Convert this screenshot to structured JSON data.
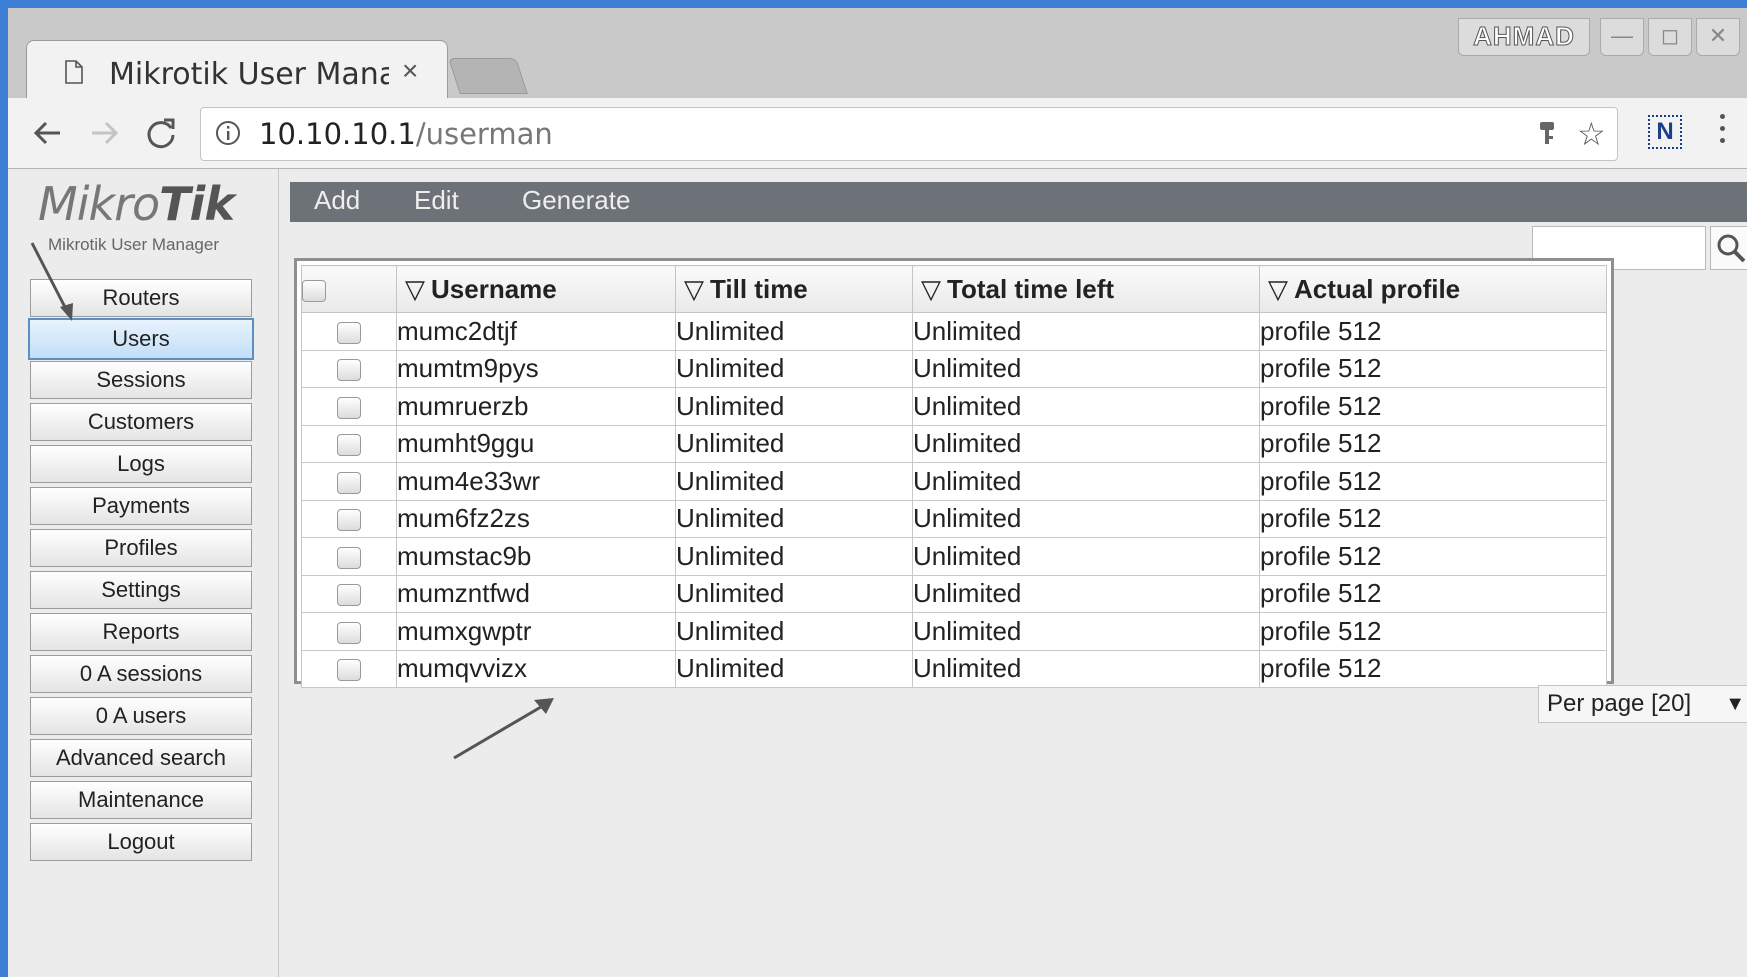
{
  "browser": {
    "tab_title": "Mikrotik User Mana",
    "tab_close": "×",
    "profile_name": "AHMAD",
    "window_controls": {
      "minimize": "—",
      "maximize": "◻",
      "close": "✕"
    },
    "url_host": "10.10.10.1",
    "url_path": "/userman",
    "extension_label": "N",
    "icons": [
      "document-icon",
      "back-icon",
      "forward-icon",
      "reload-icon",
      "info-icon",
      "key-icon",
      "star-icon",
      "menu-icon"
    ]
  },
  "sidebar": {
    "logo_light": "Mikro",
    "logo_bold": "Tik",
    "logo_subtitle": "Mikrotik User Manager",
    "items": [
      {
        "label": "Routers"
      },
      {
        "label": "Users",
        "active": true
      },
      {
        "label": "Sessions"
      },
      {
        "label": "Customers"
      },
      {
        "label": "Logs"
      },
      {
        "label": "Payments"
      },
      {
        "label": "Profiles"
      },
      {
        "label": "Settings"
      },
      {
        "label": "Reports"
      },
      {
        "label": "0 A sessions"
      },
      {
        "label": "0 A users"
      },
      {
        "label": "Advanced search"
      },
      {
        "label": "Maintenance"
      },
      {
        "label": "Logout"
      }
    ]
  },
  "actions": {
    "add": "Add",
    "edit": "Edit",
    "generate": "Generate"
  },
  "table": {
    "sort_glyph": "▽",
    "columns": [
      "Username",
      "Till time",
      "Total time left",
      "Actual profile"
    ],
    "rows": [
      [
        "mumc2dtjf",
        "Unlimited",
        "Unlimited",
        "profile 512"
      ],
      [
        "mumtm9pys",
        "Unlimited",
        "Unlimited",
        "profile 512"
      ],
      [
        "mumruerzb",
        "Unlimited",
        "Unlimited",
        "profile 512"
      ],
      [
        "mumht9ggu",
        "Unlimited",
        "Unlimited",
        "profile 512"
      ],
      [
        "mum4e33wr",
        "Unlimited",
        "Unlimited",
        "profile 512"
      ],
      [
        "mum6fz2zs",
        "Unlimited",
        "Unlimited",
        "profile 512"
      ],
      [
        "mumstac9b",
        "Unlimited",
        "Unlimited",
        "profile 512"
      ],
      [
        "mumzntfwd",
        "Unlimited",
        "Unlimited",
        "profile 512"
      ],
      [
        "mumxgwptr",
        "Unlimited",
        "Unlimited",
        "profile 512"
      ],
      [
        "mumqvvizx",
        "Unlimited",
        "Unlimited",
        "profile 512"
      ]
    ]
  },
  "pagination": {
    "per_page_label": "Per page [20]",
    "arrow": "▼"
  },
  "colors": {
    "desktop": "#3d7fd6",
    "actionbar": "#6c7277",
    "active_item_border": "#5b8fbf"
  }
}
